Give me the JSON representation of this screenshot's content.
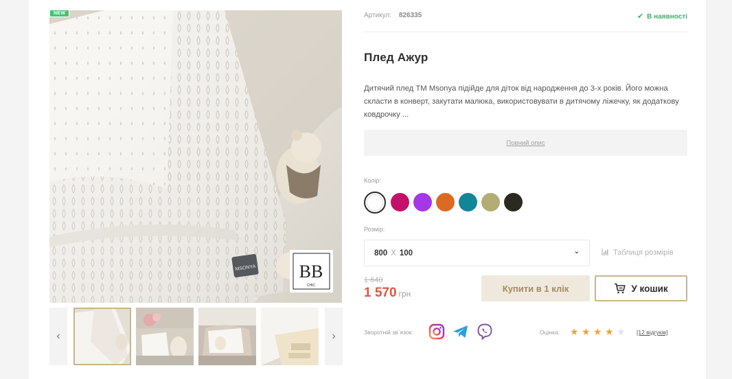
{
  "gallery": {
    "badge": "NEW",
    "logo_text": "ВВ",
    "logo_sub": "CHIC",
    "tag_text": "MSONYA",
    "prev_arrow": "‹",
    "next_arrow": "›"
  },
  "product": {
    "sku_label": "Артикул:",
    "sku_value": "826335",
    "stock_status": "В наявності",
    "title": "Плед Ажур",
    "description": "Дитячий плед ТМ Msonya підійде для діток від народження до 3-х років. Його можна скласти в конверт, закутати малюка, використовувати в дитячому ліжечку, як додаткову ковдрочку ...",
    "full_description_link": "Повний опис"
  },
  "color": {
    "label": "Колір:",
    "options": [
      "#ffffff",
      "#c4106b",
      "#a537e6",
      "#dd6a22",
      "#138599",
      "#b3ad75",
      "#2b2a21"
    ]
  },
  "size": {
    "label": "Розмір:",
    "width": "800",
    "sep": "X",
    "height": "100",
    "chevron": "⌄",
    "table_link": "Таблиця розмірів"
  },
  "price": {
    "old": "1 640",
    "current": "1 570",
    "currency": "грн"
  },
  "actions": {
    "one_click": "Купити в 1 клік",
    "add_to_cart": "У кошик"
  },
  "footer": {
    "feedback_label": "Зворотній зв`язок:",
    "rating_label": "Оцінка:",
    "rating": 4,
    "rating_max": 5,
    "reviews": "[12 відгуків]"
  },
  "colors": {
    "accent_gold": "#c9b48f",
    "price_red": "#e0553e",
    "stock_green": "#3bb36b",
    "star_orange": "#f0a23a"
  }
}
